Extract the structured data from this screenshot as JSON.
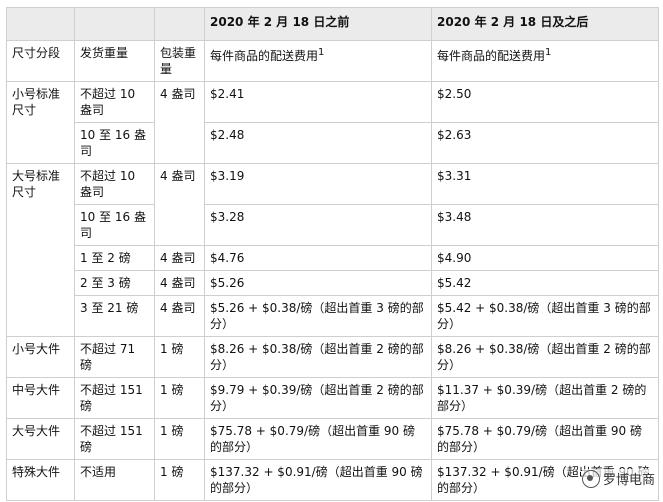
{
  "headers": {
    "col1": "",
    "col2": "",
    "col3": "",
    "before": "2020 年 2 月 18 日之前",
    "after": "2020 年 2 月 18 日及之后"
  },
  "subheader": {
    "tier": "尺寸分段",
    "weight": "发货重量",
    "packaging": "包装重量",
    "fee_label": "每件商品的配送费用",
    "sup": "1"
  },
  "rows": [
    {
      "tier": "小号标准尺寸",
      "weight": "不超过 10 盎司",
      "packaging": "4 盎司",
      "before": "$2.41",
      "after": "$2.50"
    },
    {
      "tier": "",
      "weight": "10 至 16 盎司",
      "packaging": "",
      "before": "$2.48",
      "after": "$2.63"
    },
    {
      "tier": "大号标准尺寸",
      "weight": "不超过 10 盎司",
      "packaging": "4 盎司",
      "before": "$3.19",
      "after": "$3.31"
    },
    {
      "tier": "",
      "weight": "10 至 16 盎司",
      "packaging": "",
      "before": "$3.28",
      "after": "$3.48"
    },
    {
      "tier": "",
      "weight": "1 至 2 磅",
      "packaging": "4 盎司",
      "before": "$4.76",
      "after": "$4.90"
    },
    {
      "tier": "",
      "weight": "2 至 3 磅",
      "packaging": "4 盎司",
      "before": "$5.26",
      "after": "$5.42"
    },
    {
      "tier": "",
      "weight": "3 至 21 磅",
      "packaging": "4 盎司",
      "before": "$5.26 + $0.38/磅（超出首重 3 磅的部分）",
      "after": "$5.42 + $0.38/磅（超出首重 3 磅的部分）"
    },
    {
      "tier": "小号大件",
      "weight": "不超过 71 磅",
      "packaging": "1 磅",
      "before": "$8.26 + $0.38/磅（超出首重 2 磅的部分）",
      "after": "$8.26 + $0.38/磅（超出首重 2 磅的部分）"
    },
    {
      "tier": "中号大件",
      "weight": "不超过 151 磅",
      "packaging": "1 磅",
      "before": "$9.79 + $0.39/磅（超出首重 2 磅的部分）",
      "after": "$11.37 + $0.39/磅（超出首重 2 磅的部分）"
    },
    {
      "tier": "大号大件",
      "weight": "不超过 151 磅",
      "packaging": "1 磅",
      "before": "$75.78 + $0.79/磅（超出首重 90 磅的部分）",
      "after": "$75.78 + $0.79/磅（超出首重 90 磅的部分）"
    },
    {
      "tier": "特殊大件",
      "weight": "不适用",
      "packaging": "1 磅",
      "before": "$137.32 + $0.91/磅（超出首重 90 磅的部分）",
      "after": "$137.32 + $0.91/磅（超出首重 90 磅的部分）"
    }
  ],
  "watermark": {
    "text": "罗博电商",
    "icon": "wechat-icon"
  }
}
